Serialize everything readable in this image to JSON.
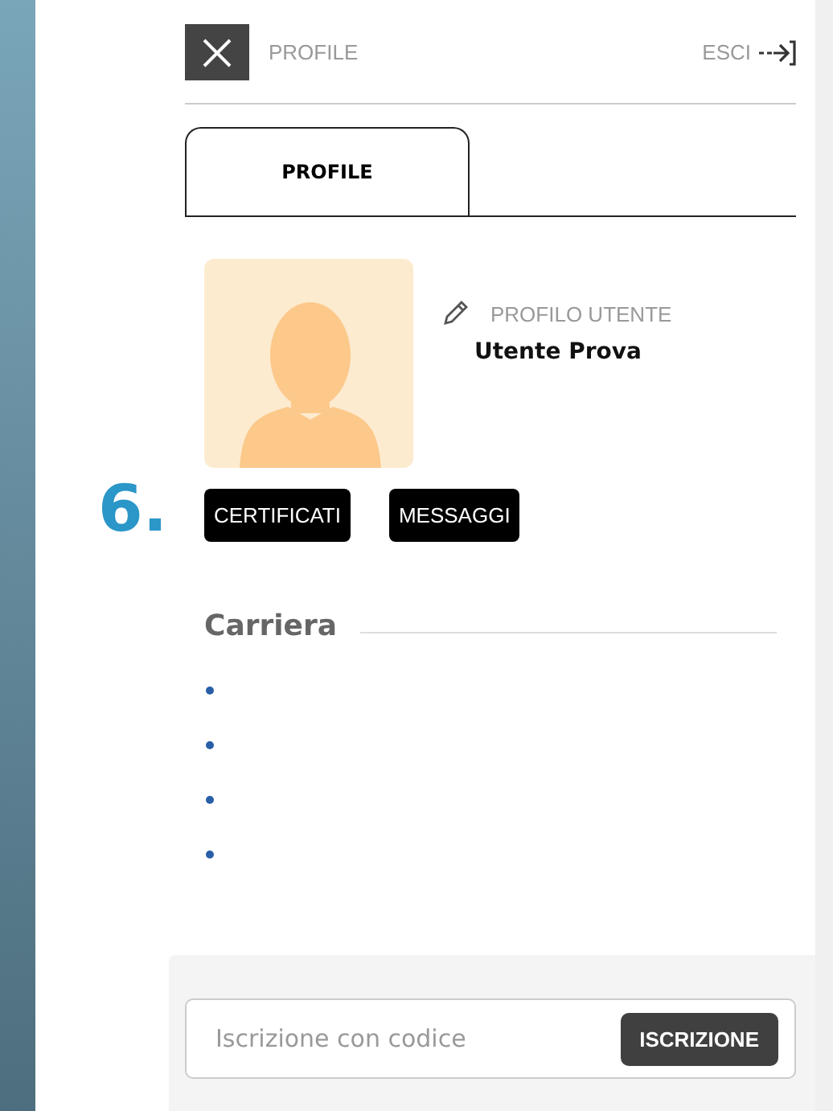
{
  "header": {
    "title": "PROFILE",
    "logout": "ESCI"
  },
  "tabs": [
    {
      "label": "PROFILE",
      "selected": true
    }
  ],
  "profile": {
    "caption": "PROFILO UTENTE",
    "name": "Utente Prova"
  },
  "step_marker": "6.",
  "buttons": [
    "CERTIFICATI",
    "MESSAGGI"
  ],
  "career": {
    "title": "Carriera",
    "items": [
      {
        "kind": "bullet"
      },
      {
        "kind": "bullet"
      },
      {
        "kind": "bullet"
      },
      {
        "kind": "bullet"
      }
    ]
  },
  "enroll": {
    "placeholder": "Iscrizione con codice",
    "button": "ISCRIZIONE"
  }
}
